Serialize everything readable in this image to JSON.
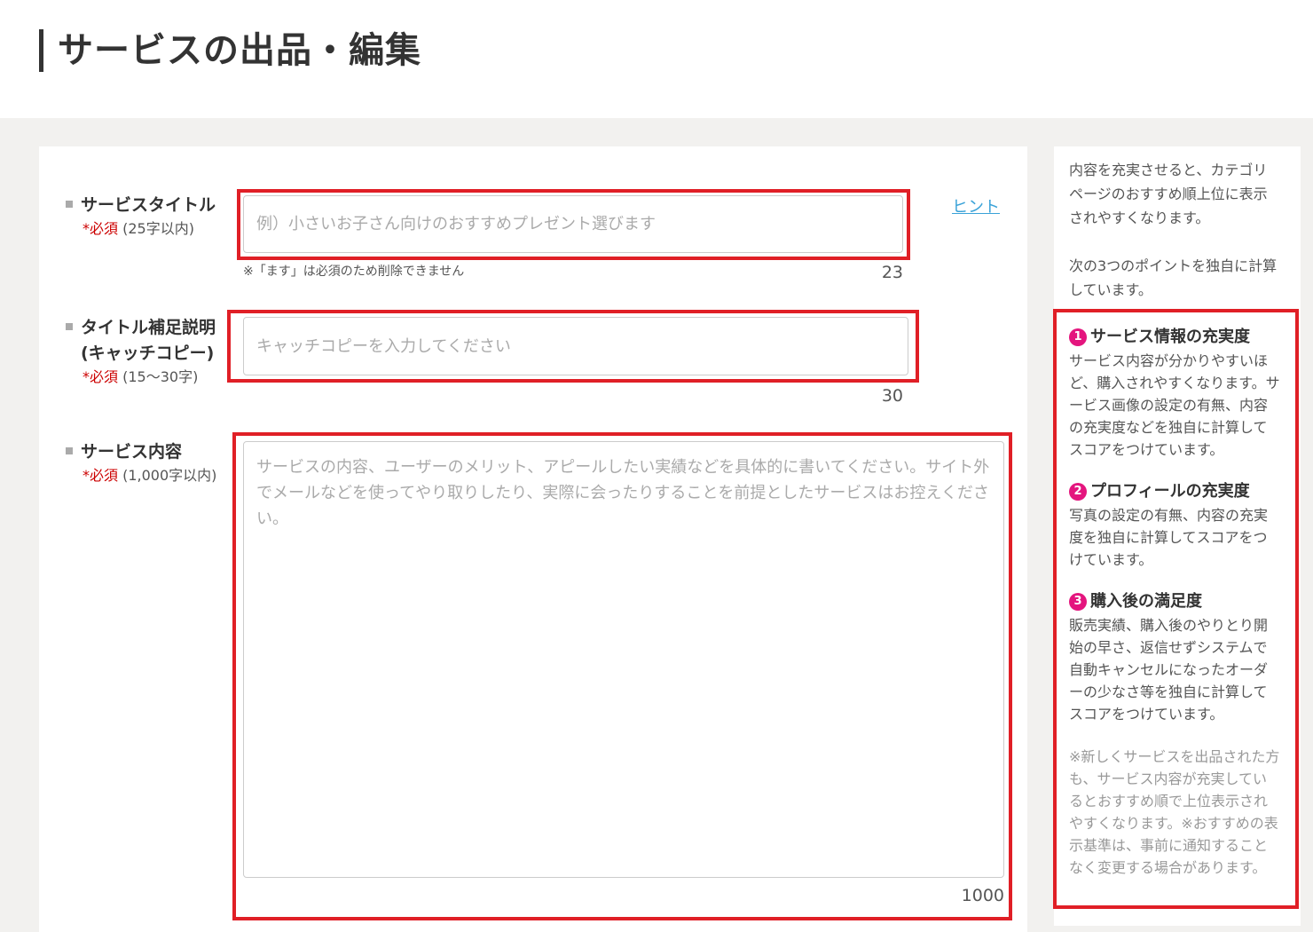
{
  "header": {
    "title": "サービスの出品・編集"
  },
  "form": {
    "title_field": {
      "label": "サービスタイトル",
      "required": "*必須",
      "limit": " (25字以内)",
      "placeholder": "例）小さいお子さん向けのおすすめプレゼント選びます",
      "note": "※「ます」は必須のため削除できません",
      "counter": "23",
      "hint": "ヒント"
    },
    "catch_field": {
      "label_line1": "タイトル補足説明",
      "label_line2": "(キャッチコピー)",
      "required": "*必須",
      "limit": " (15～30字)",
      "placeholder": "キャッチコピーを入力してください",
      "counter": "30"
    },
    "content_field": {
      "label": "サービス内容",
      "required": "*必須",
      "limit": " (1,000字以内)",
      "placeholder": "サービスの内容、ユーザーのメリット、アピールしたい実績などを具体的に書いてください。サイト外でメールなどを使ってやり取りしたり、実際に会ったりすることを前提としたサービスはお控えください。",
      "counter": "1000"
    }
  },
  "sidebar": {
    "intro1": "内容を充実させると、カテゴリページのおすすめ順上位に表示されやすくなります。",
    "intro2": "次の3つのポイントを独自に計算しています。",
    "points": [
      {
        "num": "1",
        "title": "サービス情報の充実度",
        "body": "サービス内容が分かりやすいほど、購入されやすくなります。サービス画像の設定の有無、内容の充実度などを独自に計算してスコアをつけています。"
      },
      {
        "num": "2",
        "title": "プロフィールの充実度",
        "body": "写真の設定の有無、内容の充実度を独自に計算してスコアをつけています。"
      },
      {
        "num": "3",
        "title": "購入後の満足度",
        "body": "販売実績、購入後のやりとり開始の早さ、返信せずシステムで自動キャンセルになったオーダーの少なさ等を独自に計算してスコアをつけています。"
      }
    ],
    "note": "※新しくサービスを出品された方も、サービス内容が充実しているとおすすめ順で上位表示されやすくなります。※おすすめの表示基準は、事前に通知することなく変更する場合があります。"
  },
  "colors": {
    "highlight": "#e01f26",
    "accent": "#e4157e",
    "link": "#3aa2d8",
    "required": "#cc0000"
  }
}
